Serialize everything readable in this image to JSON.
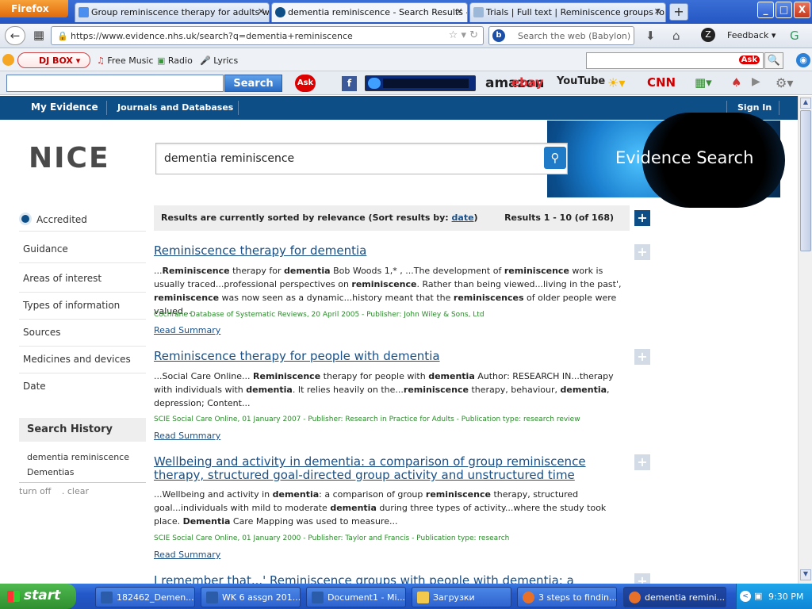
{
  "browser": {
    "menu_button": "Firefox",
    "tabs": [
      {
        "title": "Group reminiscence therapy for adults wi...",
        "favicon": "google-favicon",
        "active": false
      },
      {
        "title": "dementia reminiscence - Search Results - ...",
        "favicon": "nice-favicon",
        "active": true
      },
      {
        "title": "Trials | Full text | Reminiscence groups fo...",
        "favicon": "trials-favicon",
        "active": false
      }
    ],
    "new_tab": "+",
    "url": "https://www.evidence.nhs.uk/search?q=dementia+reminiscence",
    "web_search_placeholder": "Search the web (Babylon)",
    "feedback": "Feedback",
    "window_controls": {
      "minimize": "_",
      "maximize": "□",
      "close": "X"
    }
  },
  "bookmarks": {
    "djbox": "DJ BOX",
    "items": [
      "Free Music",
      "Radio",
      "Lyrics"
    ]
  },
  "toolbar3": {
    "search_button": "Search",
    "ask_logo": "Ask",
    "shortcuts": [
      "amazon",
      "ebay",
      "YouTube",
      "CNN"
    ]
  },
  "site": {
    "nav": {
      "my_evidence": "My Evidence",
      "journals": "Journals and Databases",
      "sign_in": "Sign In"
    },
    "logo": "NICE",
    "search_value": "dementia reminiscence",
    "banner_text": "Evidence Search",
    "sidebar": {
      "accredited": "Accredited",
      "filters": [
        "Guidance",
        "Areas of interest",
        "Types of information",
        "Sources",
        "Medicines and devices",
        "Date"
      ],
      "history_title": "Search History",
      "history": [
        "dementia reminiscence",
        "Dementias"
      ],
      "turn_off": "turn off",
      "clear": ". clear"
    },
    "sort": {
      "label": "Results are currently sorted by relevance (Sort results by:",
      "date_link": "date",
      "close": ")",
      "count": "Results 1 - 10 (of 168)"
    },
    "results": [
      {
        "title": "Reminiscence therapy for dementia",
        "meta": "Cochrane Database of Systematic Reviews, 20 April 2005 - Publisher: John Wiley & Sons, Ltd",
        "read": "Read Summary"
      },
      {
        "title": "Reminiscence therapy for people with dementia",
        "meta": "SCIE Social Care Online, 01 January 2007 - Publisher: Research in Practice for Adults - Publication type: research review",
        "read": "Read Summary"
      },
      {
        "title": "Wellbeing and activity in dementia: a comparison of group reminiscence therapy, structured goal-directed group activity and unstructured time",
        "meta": "SCIE Social Care Online, 01 January 2000 - Publisher: Taylor and Francis - Publication type: research",
        "read": "Read Summary"
      },
      {
        "title": "I remember that...' Reminiscence groups with people with dementia: a"
      }
    ]
  },
  "taskbar": {
    "start": "start",
    "tasks": [
      "182462_Demen...",
      "WK 6 assgn 201...",
      "Document1 - Mi...",
      "Загрузки",
      "3 steps to findin...",
      "dementia remini..."
    ],
    "clock": "9:30 PM"
  }
}
